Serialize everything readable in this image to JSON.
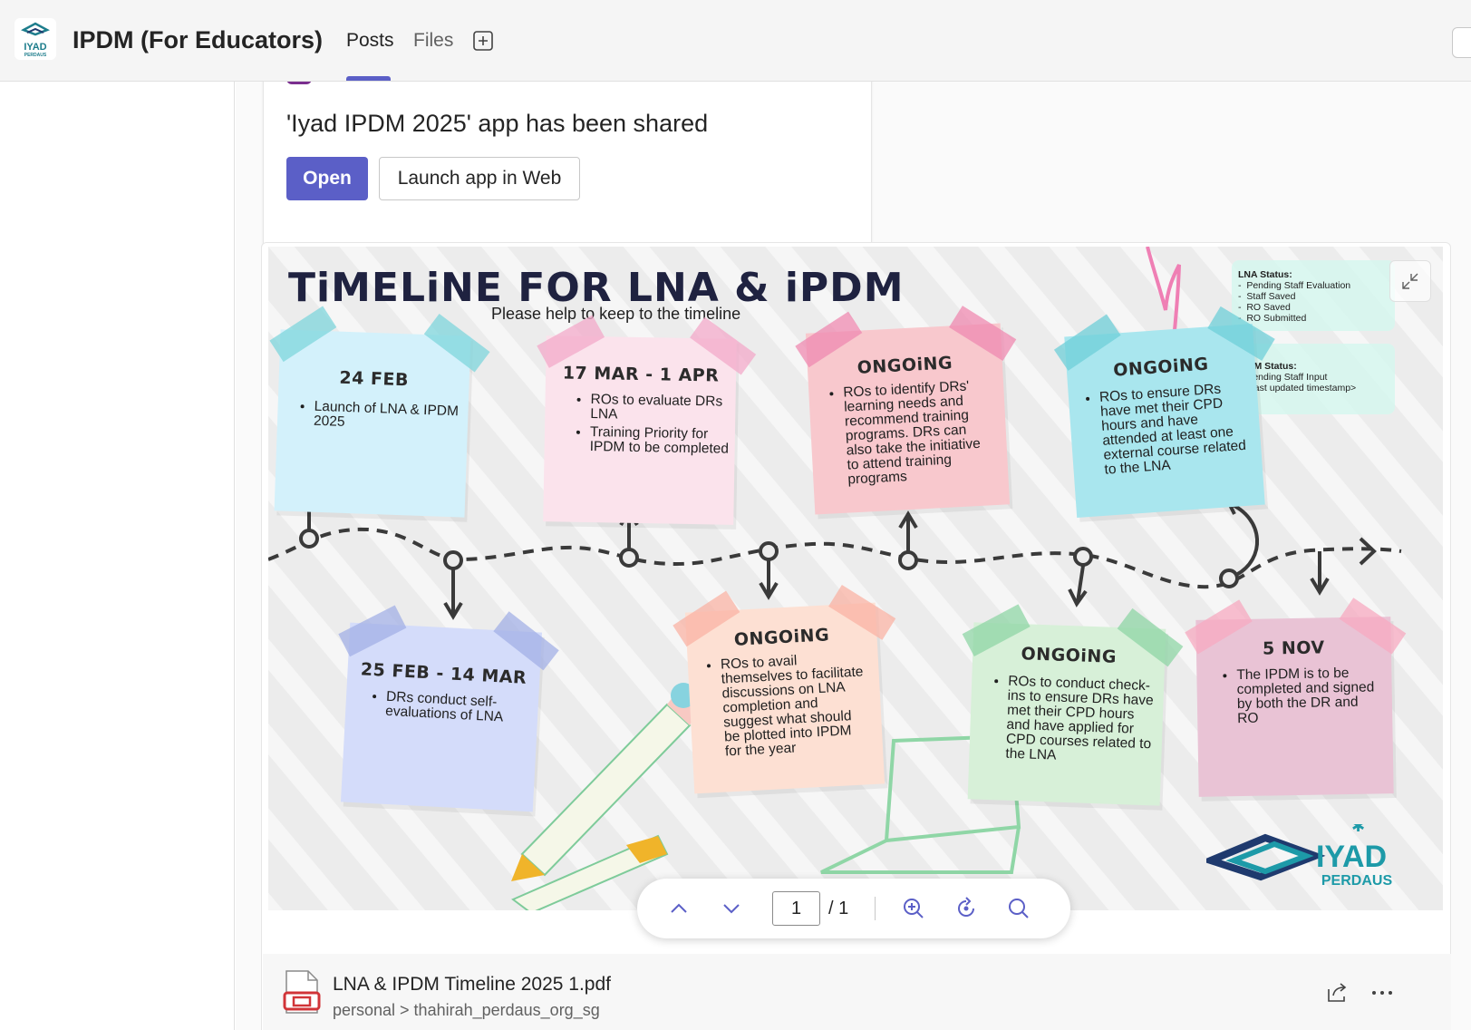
{
  "header": {
    "team_title": "IPDM (For Educators)",
    "tabs": [
      {
        "label": "Posts",
        "active": true
      },
      {
        "label": "Files",
        "active": false
      }
    ],
    "logo_text_top": "IYAD",
    "logo_text_bottom": "PERDAUS",
    "accent_color": "#5b5fc7"
  },
  "app_card": {
    "message": "'Iyad IPDM 2025' app has been shared",
    "open_label": "Open",
    "web_label": "Launch app in Web"
  },
  "pdf": {
    "poster": {
      "title": "TiMELiNE FOR LNA & iPDM",
      "subtitle": "Please help to keep to the timeline",
      "lna_status": {
        "heading": "LNA Status:",
        "items": [
          "Pending Staff Evaluation",
          "Staff Saved",
          "RO Saved",
          "RO Submitted"
        ]
      },
      "ipdm_status": {
        "heading": "IPDM Status:",
        "items": [
          "Pending Staff Input",
          "<last updated timestamp>"
        ]
      },
      "notes": [
        {
          "heading": "24 FEB",
          "items": [
            "Launch of LNA & IPDM 2025"
          ]
        },
        {
          "heading": "17 MAR - 1 APR",
          "items": [
            "ROs to evaluate DRs LNA",
            "Training Priority for IPDM to be completed"
          ]
        },
        {
          "heading": "ONGOiNG",
          "items": [
            "ROs to identify DRs' learning needs and recommend training programs. DRs can also take the initiative to attend training programs"
          ]
        },
        {
          "heading": "ONGOiNG",
          "items": [
            "ROs to ensure DRs have met their CPD hours and have attended at least one external course related to the LNA"
          ]
        },
        {
          "heading": "25 FEB - 14 MAR",
          "items": [
            "DRs conduct self-evaluations of LNA"
          ]
        },
        {
          "heading": "ONGOiNG",
          "items": [
            "ROs to avail themselves to facilitate discussions on LNA completion and suggest what should be plotted into IPDM for the year"
          ]
        },
        {
          "heading": "ONGOiNG",
          "items": [
            "ROs to conduct check-ins to ensure DRs have met their CPD hours and have applied for CPD courses related to the LNA"
          ]
        },
        {
          "heading": "5 NOV",
          "items": [
            "The IPDM is to be completed and signed by both the DR and RO"
          ]
        }
      ],
      "brand_top": "IYAD",
      "brand_bottom": "PERDAUS"
    },
    "toolbar": {
      "current_page": "1",
      "page_total": "/ 1"
    }
  },
  "file": {
    "name": "LNA & IPDM Timeline 2025 1.pdf",
    "path": "personal > thahirah_perdaus_org_sg"
  }
}
